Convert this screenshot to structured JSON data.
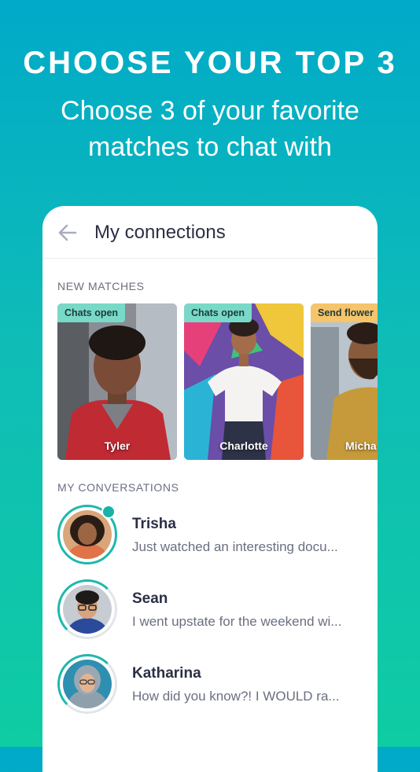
{
  "promo": {
    "headline": "CHOOSE YOUR TOP 3",
    "subhead": "Choose 3 of your favorite matches to chat with"
  },
  "screen": {
    "title": "My connections",
    "back_icon": "arrow-left-icon"
  },
  "new_matches": {
    "label": "NEW MATCHES",
    "cards": [
      {
        "name": "Tyler",
        "badge": "Chats open",
        "badge_color": "#79d9c8"
      },
      {
        "name": "Charlotte",
        "badge": "Chats open",
        "badge_color": "#79d9c8"
      },
      {
        "name": "Micha",
        "badge": "Send flower",
        "badge_color": "#f6c46a"
      }
    ]
  },
  "conversations": {
    "label": "MY CONVERSATIONS",
    "items": [
      {
        "name": "Trisha",
        "message": "Just watched an interesting docu...",
        "online": true
      },
      {
        "name": "Sean",
        "message": "I went upstate for the weekend wi...",
        "online": false
      },
      {
        "name": "Katharina",
        "message": "How did you know?! I WOULD ra...",
        "online": false
      }
    ]
  },
  "colors": {
    "accent": "#1fb8ad",
    "title_text": "#2b2f45",
    "secondary_text": "#6b6f80"
  }
}
